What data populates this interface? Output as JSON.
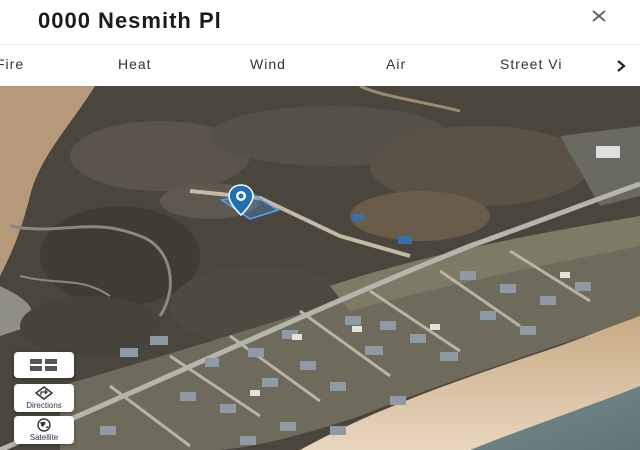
{
  "header": {
    "title": "0000 Nesmith Pl",
    "close_icon": "close-icon"
  },
  "tabs": [
    {
      "label": "Fire"
    },
    {
      "label": "Heat"
    },
    {
      "label": "Wind"
    },
    {
      "label": "Air"
    },
    {
      "label": "Street Vi"
    }
  ],
  "tabs_more_icon": "chevron-right-icon",
  "map": {
    "view": "satellite",
    "pin_icon": "location-pin-icon",
    "pin_color": "#1f6fb5",
    "parcel_color": "#4ea3ff"
  },
  "controls": {
    "layers": {
      "icon": "grid-icon"
    },
    "directions": {
      "icon": "directions-icon",
      "label": "Directions"
    },
    "satellite": {
      "icon": "globe-icon",
      "label": "Satellite"
    }
  }
}
